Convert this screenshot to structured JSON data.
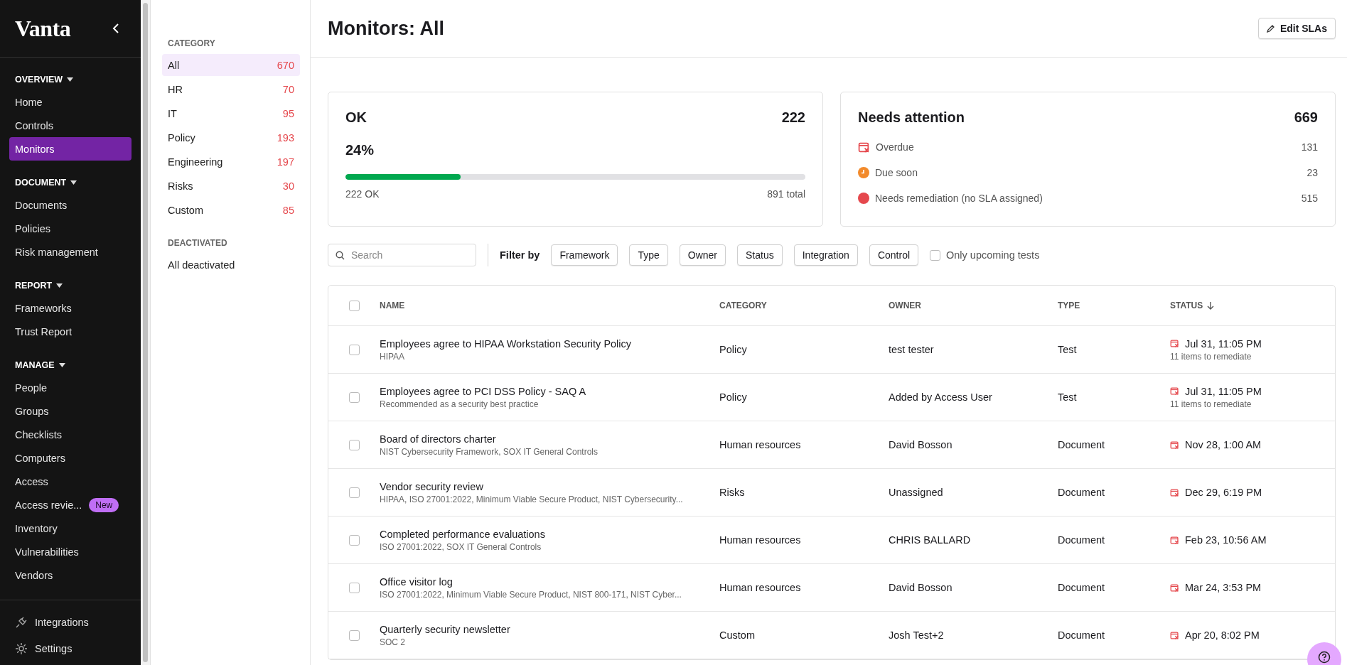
{
  "sidebar": {
    "logo": "Vanta",
    "sections": [
      {
        "title": "OVERVIEW",
        "items": [
          {
            "label": "Home",
            "selected": false
          },
          {
            "label": "Controls",
            "selected": false
          },
          {
            "label": "Monitors",
            "selected": true
          }
        ]
      },
      {
        "title": "DOCUMENT",
        "items": [
          {
            "label": "Documents",
            "selected": false
          },
          {
            "label": "Policies",
            "selected": false
          },
          {
            "label": "Risk management",
            "selected": false
          }
        ]
      },
      {
        "title": "REPORT",
        "items": [
          {
            "label": "Frameworks",
            "selected": false
          },
          {
            "label": "Trust Report",
            "selected": false
          }
        ]
      },
      {
        "title": "MANAGE",
        "items": [
          {
            "label": "People",
            "selected": false
          },
          {
            "label": "Groups",
            "selected": false
          },
          {
            "label": "Checklists",
            "selected": false
          },
          {
            "label": "Computers",
            "selected": false
          },
          {
            "label": "Access",
            "selected": false
          },
          {
            "label": "Access revie...",
            "selected": false,
            "badge": "New"
          },
          {
            "label": "Inventory",
            "selected": false
          },
          {
            "label": "Vulnerabilities",
            "selected": false
          },
          {
            "label": "Vendors",
            "selected": false
          }
        ]
      }
    ],
    "footer_items": [
      {
        "kind": "plug",
        "label": "Integrations"
      },
      {
        "kind": "gear",
        "label": "Settings"
      }
    ]
  },
  "category_panel": {
    "groups": [
      {
        "title": "CATEGORY",
        "items": [
          {
            "label": "All",
            "count": "670",
            "selected": true
          },
          {
            "label": "HR",
            "count": "70",
            "selected": false
          },
          {
            "label": "IT",
            "count": "95",
            "selected": false
          },
          {
            "label": "Policy",
            "count": "193",
            "selected": false
          },
          {
            "label": "Engineering",
            "count": "197",
            "selected": false
          },
          {
            "label": "Risks",
            "count": "30",
            "selected": false
          },
          {
            "label": "Custom",
            "count": "85",
            "selected": false
          }
        ]
      },
      {
        "title": "DEACTIVATED",
        "items": [
          {
            "label": "All deactivated",
            "selected": false
          }
        ]
      }
    ]
  },
  "header": {
    "title": "Monitors: All",
    "edit_button": "Edit SLAs"
  },
  "ok_card": {
    "title": "OK",
    "count": "222",
    "percent": "24%",
    "level": 0.25,
    "left_label": "222 OK",
    "right_label": "891 total"
  },
  "attention_card": {
    "title": "Needs attention",
    "count": "669",
    "items": [
      {
        "kind": "overdue",
        "label": "Overdue",
        "count": "131"
      },
      {
        "kind": "due_soon",
        "label": "Due soon",
        "count": "23"
      },
      {
        "kind": "remediation",
        "label": "Needs remediation (no SLA assigned)",
        "count": "515"
      }
    ]
  },
  "filters": {
    "search_placeholder": "Search",
    "filter_label": "Filter by",
    "buttons": [
      "Framework",
      "Type",
      "Owner",
      "Status",
      "Integration",
      "Control"
    ],
    "checkbox": {
      "label": "Only upcoming tests",
      "checked": false
    }
  },
  "table": {
    "select_all_checked": false,
    "columns": [
      {
        "label": "NAME",
        "sorted": false
      },
      {
        "label": "CATEGORY",
        "sorted": false
      },
      {
        "label": "OWNER",
        "sorted": false
      },
      {
        "label": "TYPE",
        "sorted": false
      },
      {
        "label": "STATUS",
        "sorted": true
      }
    ],
    "rows": [
      {
        "checked": false,
        "name": "Employees agree to HIPAA Workstation Security Policy",
        "subtitle": "HIPAA",
        "category": "Policy",
        "owner": "test tester",
        "type": "Test",
        "status": "Jul 31, 11:05 PM",
        "status_note": "11 items to remediate"
      },
      {
        "checked": false,
        "name": "Employees agree to PCI DSS Policy - SAQ A",
        "subtitle": "Recommended as a security best practice",
        "category": "Policy",
        "owner": "Added by Access User",
        "type": "Test",
        "status": "Jul 31, 11:05 PM",
        "status_note": "11 items to remediate"
      },
      {
        "checked": false,
        "name": "Board of directors charter",
        "subtitle": "NIST Cybersecurity Framework, SOX IT General Controls",
        "category": "Human resources",
        "owner": "David Bosson",
        "type": "Document",
        "status": "Nov 28, 1:00 AM"
      },
      {
        "checked": false,
        "name": "Vendor security review",
        "subtitle": "HIPAA, ISO 27001:2022, Minimum Viable Secure Product, NIST Cybersecurity...",
        "category": "Risks",
        "owner": "Unassigned",
        "type": "Document",
        "status": "Dec 29, 6:19 PM"
      },
      {
        "checked": false,
        "name": "Completed performance evaluations",
        "subtitle": "ISO 27001:2022, SOX IT General Controls",
        "category": "Human resources",
        "owner": "CHRIS BALLARD",
        "type": "Document",
        "status": "Feb 23, 10:56 AM"
      },
      {
        "checked": false,
        "name": "Office visitor log",
        "subtitle": "ISO 27001:2022, Minimum Viable Secure Product, NIST 800-171, NIST Cyber...",
        "category": "Human resources",
        "owner": "David Bosson",
        "type": "Document",
        "status": "Mar 24, 3:53 PM"
      },
      {
        "checked": false,
        "name": "Quarterly security newsletter",
        "subtitle": "SOC 2",
        "category": "Custom",
        "owner": "Josh Test+2",
        "type": "Document",
        "status": "Apr 20, 8:02 PM"
      }
    ]
  }
}
